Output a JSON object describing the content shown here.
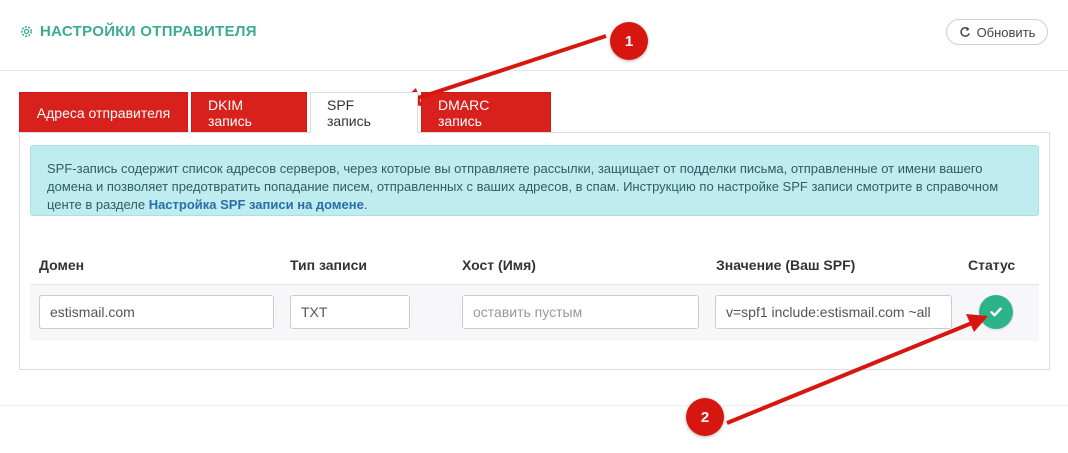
{
  "header": {
    "title": "НАСТРОЙКИ ОТПРАВИТЕЛЯ",
    "refresh_label": "Обновить"
  },
  "tabs": [
    {
      "label": "Адреса отправителя",
      "active": false
    },
    {
      "label": "DKIM запись",
      "active": false
    },
    {
      "label": "SPF запись",
      "active": true
    },
    {
      "label": "DMARC запись",
      "active": false
    }
  ],
  "info": {
    "text": "SPF-запись содержит список адресов серверов, через которые вы отправляете рассылки, защищает от подделки письма, отправленные от имени вашего домена и позволяет предотвратить попадание писем, отправленных с ваших адресов, в спам. Инструкцию по настройке SPF записи смотрите в справочном центе в разделе ",
    "link": "Настройка SPF записи на домене",
    "tail": "."
  },
  "table": {
    "headers": {
      "domain": "Домен",
      "type": "Тип записи",
      "host": "Хост (Имя)",
      "value": "Значение (Ваш SPF)",
      "status": "Статус"
    },
    "row": {
      "domain": "estismail.com",
      "type": "TXT",
      "host_placeholder": "оставить пустым",
      "value": "v=spf1 include:estismail.com ~all",
      "status_icon": "check-icon"
    }
  },
  "annotations": [
    "1",
    "2"
  ],
  "colors": {
    "accent": "#3cab91",
    "tab_red": "#d8201c",
    "status_green": "#2db38a",
    "info_bg": "#bfecef",
    "annotation_red": "#d7170f"
  }
}
